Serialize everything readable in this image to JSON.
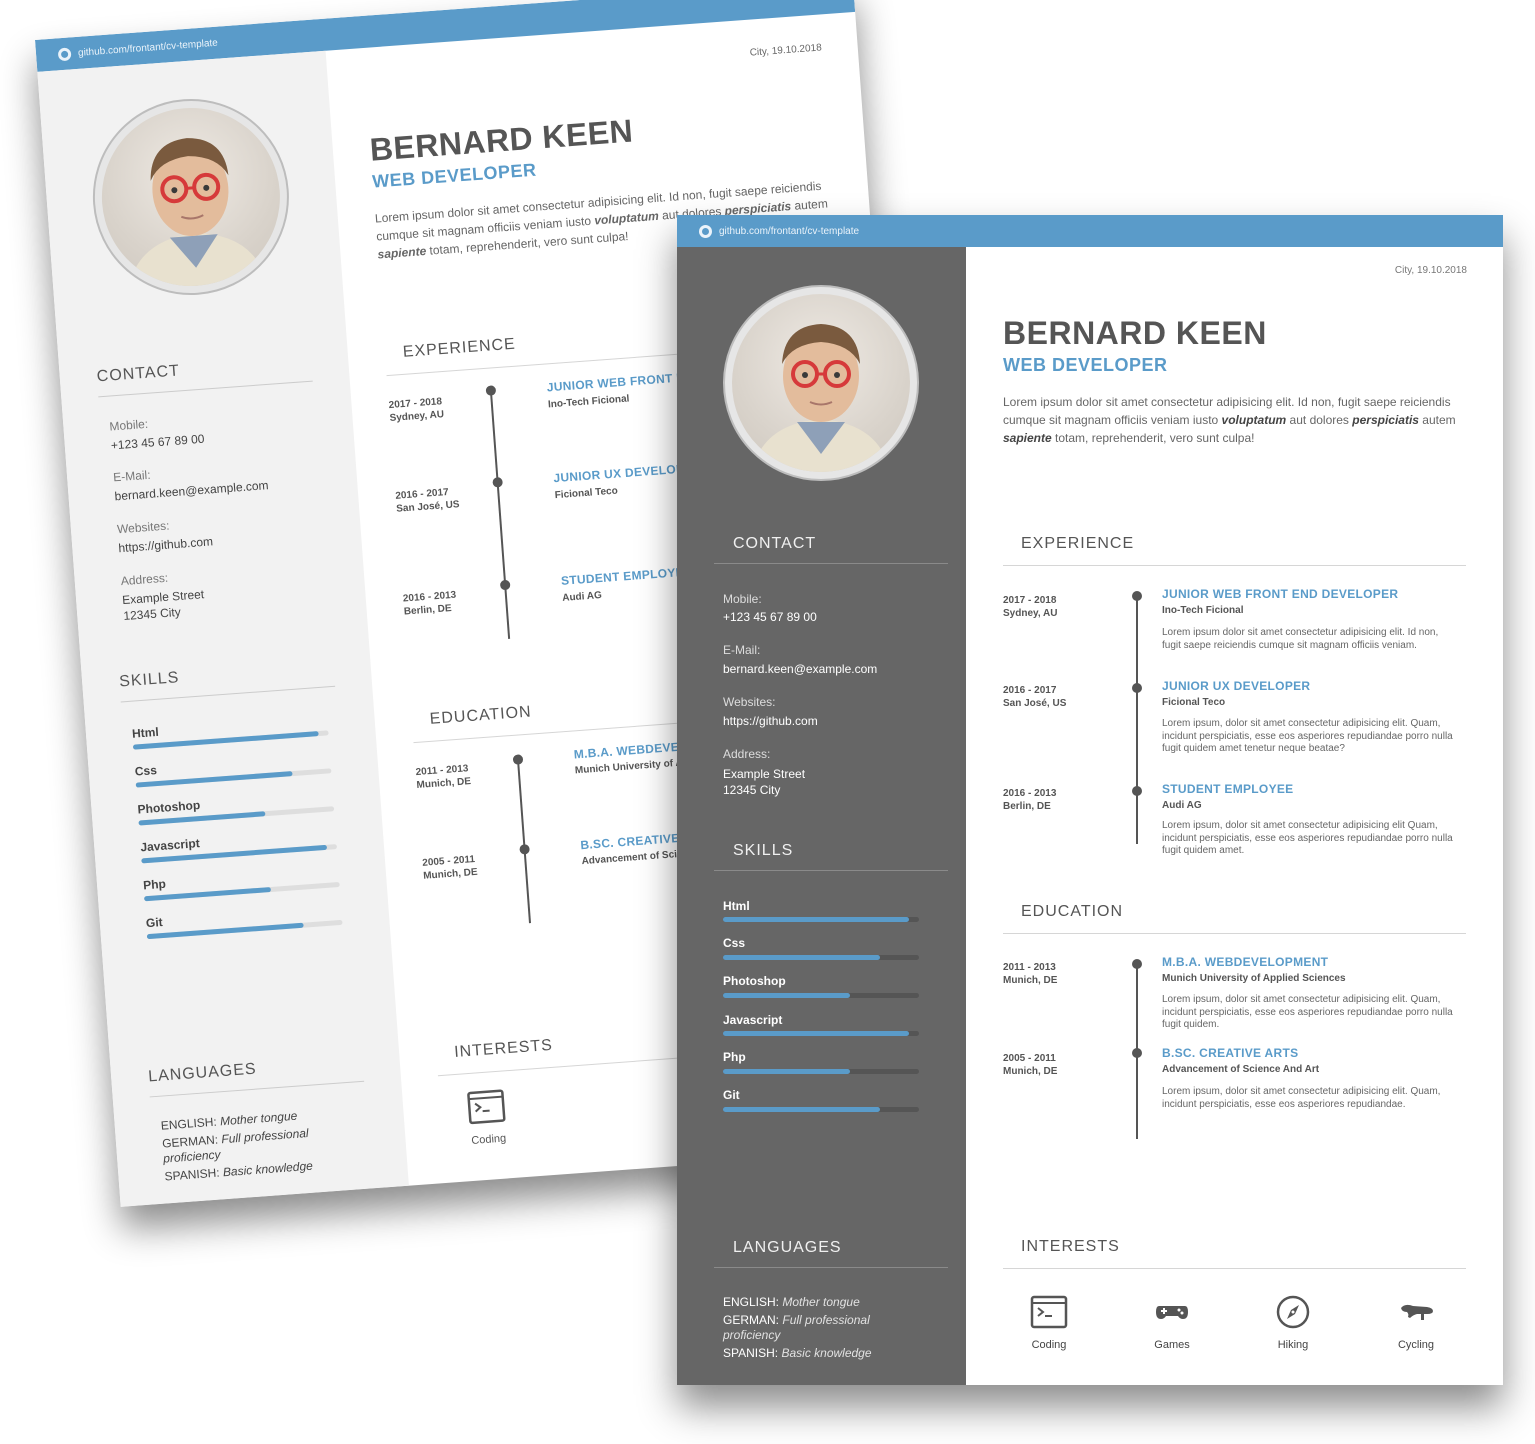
{
  "header": {
    "github_link": "github.com/frontant/cv-template"
  },
  "date_line": "City, 19.10.2018",
  "person": {
    "name": "BERNARD KEEN",
    "role": "WEB DEVELOPER",
    "intro": {
      "p1": "Lorem ipsum dolor sit amet consectetur adipisicing elit. Id non, fugit saepe reiciendis cumque sit magnam officiis veniam iusto ",
      "b1": "voluptatum",
      "p2": " aut dolores ",
      "b2": "perspiciatis",
      "p3": " autem ",
      "b3": "sapiente",
      "p4": " totam, reprehenderit, vero sunt culpa!"
    }
  },
  "contact": {
    "title": "CONTACT",
    "mobile_label": "Mobile:",
    "mobile": "+123 45 67 89 00",
    "email_label": "E-Mail:",
    "email": "bernard.keen@example.com",
    "websites_label": "Websites:",
    "website": "https://github.com",
    "address_label": "Address:",
    "address_line1": "Example Street",
    "address_line2": "12345 City"
  },
  "skills": {
    "title": "SKILLS",
    "items": [
      {
        "name": "Html",
        "level": 0.95
      },
      {
        "name": "Css",
        "level": 0.8
      },
      {
        "name": "Photoshop",
        "level": 0.65
      },
      {
        "name": "Javascript",
        "level": 0.95
      },
      {
        "name": "Php",
        "level": 0.65
      },
      {
        "name": "Git",
        "level": 0.8
      }
    ]
  },
  "languages": {
    "title": "LANGUAGES",
    "items": [
      {
        "lang": "ENGLISH:",
        "level": "Mother tongue"
      },
      {
        "lang": "GERMAN:",
        "level": "Full professional proficiency"
      },
      {
        "lang": "SPANISH:",
        "level": "Basic knowledge"
      }
    ]
  },
  "experience": {
    "title": "EXPERIENCE",
    "items": [
      {
        "period": "2017 - 2018",
        "place": "Sydney, AU",
        "title": "JUNIOR WEB FRONT END DEVELOPER",
        "org": "Ino-Tech Ficional",
        "desc": "Lorem ipsum dolor sit amet consectetur adipisicing elit. Id non, fugit saepe reiciendis cumque sit magnam officiis veniam."
      },
      {
        "period": "2016 - 2017",
        "place": "San José, US",
        "title": "JUNIOR UX DEVELOPER",
        "org": "Ficional Teco",
        "desc": "Lorem ipsum, dolor sit amet consectetur adipisicing elit. Quam, incidunt perspiciatis, esse eos asperiores repudiandae porro nulla fugit quidem amet tenetur neque beatae?"
      },
      {
        "period": "2016 - 2013",
        "place": "Berlin, DE",
        "title": "STUDENT EMPLOYEE",
        "org": "Audi AG",
        "desc": "Lorem ipsum, dolor sit amet consectetur adipisicing elit Quam, incidunt perspiciatis, esse eos asperiores repudiandae porro nulla fugit quidem amet."
      }
    ]
  },
  "education": {
    "title": "EDUCATION",
    "items": [
      {
        "period": "2011 - 2013",
        "place": "Munich, DE",
        "title": "M.B.A. WEBDEVELOPMENT",
        "org": "Munich University of Applied Sciences",
        "desc": "Lorem ipsum, dolor sit amet consectetur adipisicing elit. Quam, incidunt perspiciatis, esse eos asperiores repudiandae porro nulla fugit quidem."
      },
      {
        "period": "2005 - 2011",
        "place": "Munich, DE",
        "title": "B.SC. CREATIVE ARTS",
        "org": "Advancement of Science And Art",
        "desc": "Lorem ipsum, dolor sit amet consectetur adipisicing elit. Quam, incidunt perspiciatis, esse eos asperiores repudiandae."
      }
    ]
  },
  "interests": {
    "title": "INTERESTS",
    "items": [
      {
        "label": "Coding",
        "icon": "terminal-icon"
      },
      {
        "label": "Games",
        "icon": "gamepad-icon"
      },
      {
        "label": "Hiking",
        "icon": "compass-icon"
      },
      {
        "label": "Cycling",
        "icon": "bike-saddle-icon"
      }
    ]
  },
  "colors": {
    "accent": "#5a9bc9",
    "sidebar_dark": "#666666",
    "sidebar_light": "#f2f2f2",
    "text_dark": "#555555"
  }
}
